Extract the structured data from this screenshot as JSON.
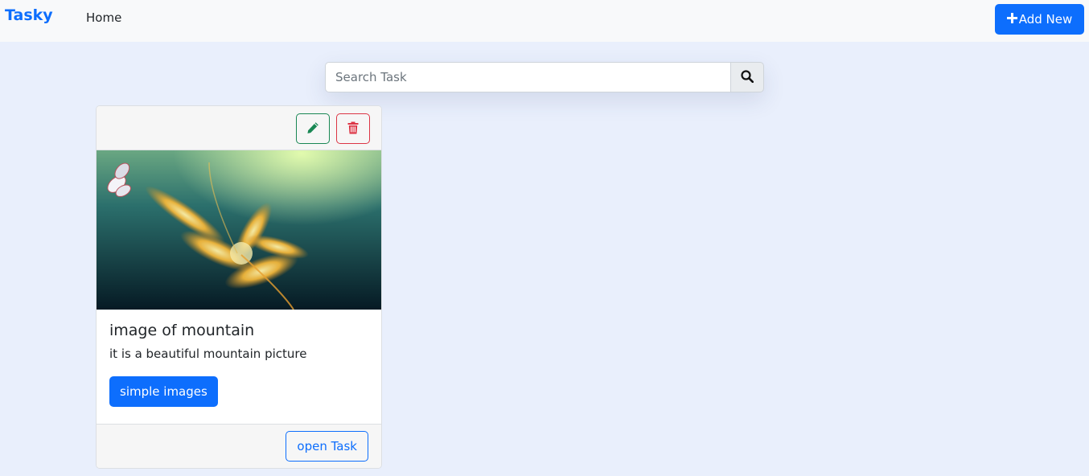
{
  "app": {
    "brand": "Tasky",
    "nav_home": "Home",
    "add_new_label": "Add New",
    "add_icon": "plus-icon"
  },
  "search": {
    "placeholder": "Search Task",
    "value": "",
    "icon": "search-icon"
  },
  "tasks": [
    {
      "title": "image of mountain",
      "description": "it is a beautiful mountain picture",
      "tag": "simple images",
      "open_label": "open Task",
      "edit_icon": "pencil-icon",
      "delete_icon": "trash-icon"
    }
  ],
  "colors": {
    "primary": "#0d6efd",
    "success": "#198754",
    "danger": "#dc3545",
    "page_background": "#e9effc"
  }
}
